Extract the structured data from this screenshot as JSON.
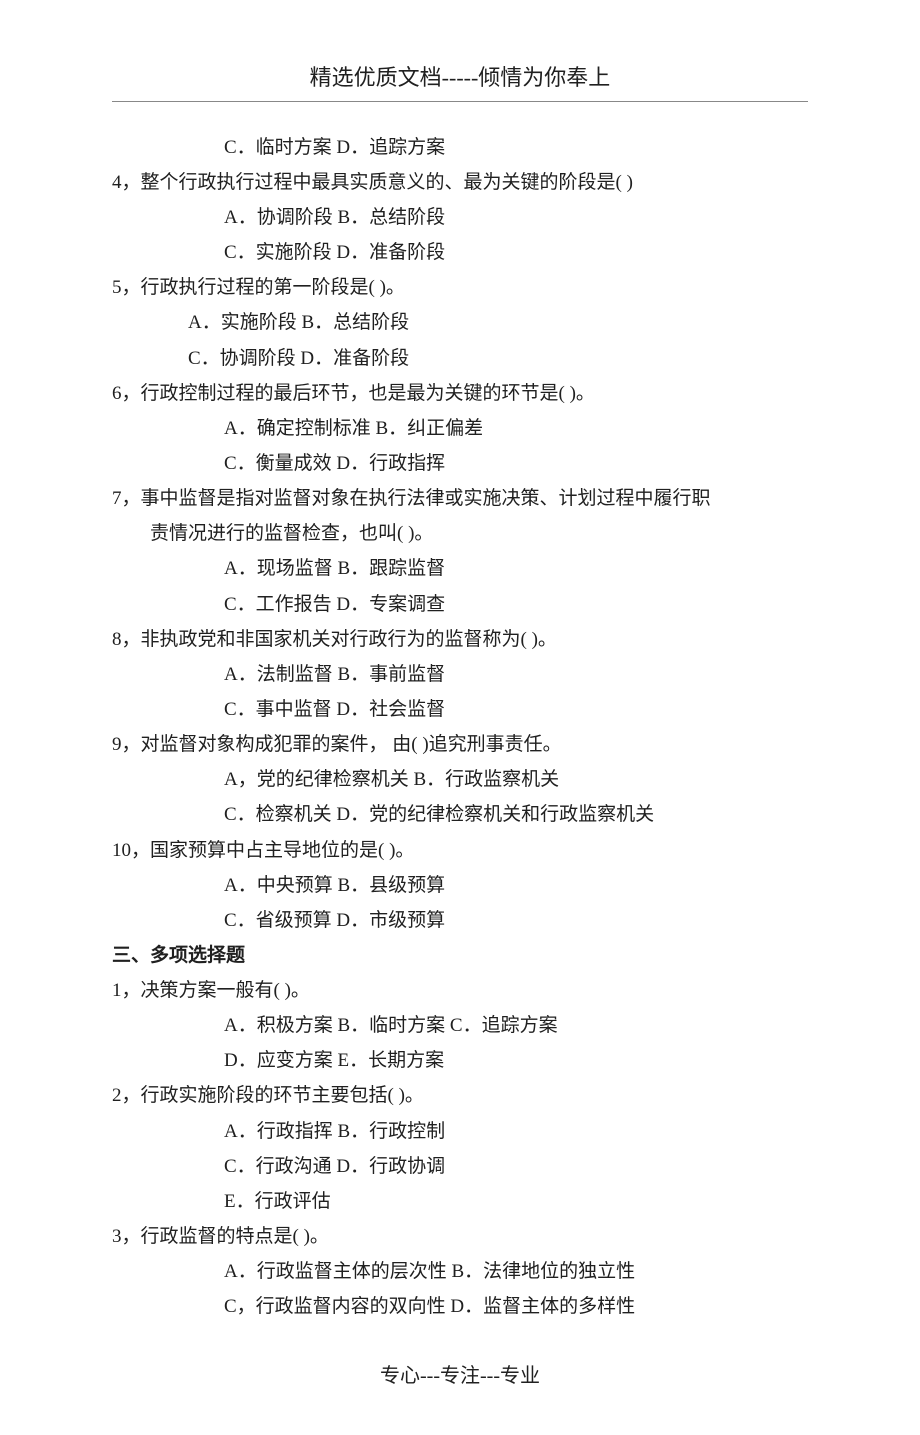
{
  "header": "精选优质文档-----倾情为你奉上",
  "footer": "专心---专注---专业",
  "lines": [
    {
      "cls": "opt-line",
      "text": "C．临时方案    D．追踪方案"
    },
    {
      "cls": "q-line",
      "text": "4，整个行政执行过程中最具实质意义的、最为关键的阶段是(    )"
    },
    {
      "cls": "opt-line",
      "text": "A．协调阶段    B．总结阶段"
    },
    {
      "cls": "opt-line",
      "text": "C．实施阶段    D．准备阶段"
    },
    {
      "cls": "q-line",
      "text": "5，行政执行过程的第一阶段是(    )。"
    },
    {
      "cls": "opt-line-short",
      "text": "A．实施阶段    B．总结阶段"
    },
    {
      "cls": "opt-line-short",
      "text": "C．协调阶段    D．准备阶段"
    },
    {
      "cls": "q-line",
      "text": "6，行政控制过程的最后环节，也是最为关键的环节是(    )。"
    },
    {
      "cls": "opt-line",
      "text": "A．确定控制标准    B．纠正偏差"
    },
    {
      "cls": "opt-line",
      "text": "C．衡量成效    D．行政指挥"
    },
    {
      "cls": "q-line",
      "text": "7，事中监督是指对监督对象在执行法律或实施决策、计划过程中履行职"
    },
    {
      "cls": "q-cont",
      "text": "责情况进行的监督检查，也叫(    )。"
    },
    {
      "cls": "opt-line",
      "text": "A．现场监督    B．跟踪监督"
    },
    {
      "cls": "opt-line",
      "text": "C．工作报告    D．专案调查"
    },
    {
      "cls": "q-line",
      "text": "8，非执政党和非国家机关对行政行为的监督称为(    )。"
    },
    {
      "cls": "opt-line",
      "text": "A．法制监督    B．事前监督"
    },
    {
      "cls": "opt-line",
      "text": "C．事中监督    D．社会监督"
    },
    {
      "cls": "q-line",
      "text": "9，对监督对象构成犯罪的案件，  由(    )追究刑事责任。"
    },
    {
      "cls": "opt-line",
      "text": "A，党的纪律检察机关    B．行政监察机关"
    },
    {
      "cls": "opt-line",
      "text": "C．检察机关    D．党的纪律检察机关和行政监察机关"
    },
    {
      "cls": "q-line",
      "text": "10，国家预算中占主导地位的是(    )。"
    },
    {
      "cls": "opt-line",
      "text": "A．中央预算    B．县级预算"
    },
    {
      "cls": "opt-line",
      "text": "C．省级预算    D．市级预算"
    },
    {
      "cls": "sec-title",
      "text": "三、多项选择题"
    },
    {
      "cls": "q-line",
      "text": "1，决策方案一般有(    )。"
    },
    {
      "cls": "opt-line",
      "text": "A．积极方案    B．临时方案    C．追踪方案"
    },
    {
      "cls": "opt-line",
      "text": "D．应变方案    E．长期方案"
    },
    {
      "cls": "q-line",
      "text": "2，行政实施阶段的环节主要包括(    )。"
    },
    {
      "cls": "opt-line",
      "text": "A．行政指挥    B．行政控制"
    },
    {
      "cls": "opt-line",
      "text": "C．行政沟通    D．行政协调"
    },
    {
      "cls": "opt-line",
      "text": "E．行政评估"
    },
    {
      "cls": "q-line",
      "text": "3，行政监督的特点是(    )。"
    },
    {
      "cls": "opt-line",
      "text": "A．行政监督主体的层次性    B．法律地位的独立性"
    },
    {
      "cls": "opt-line",
      "text": "C，行政监督内容的双向性    D．监督主体的多样性"
    }
  ]
}
